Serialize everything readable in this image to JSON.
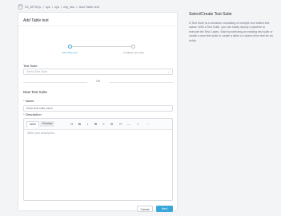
{
  "breadcrumb": {
    "segments": [
      "33_MYSQL",
      "sys",
      "sys",
      "city_sku",
      "Add Table test"
    ],
    "separator": "/"
  },
  "card": {
    "title": "Add Table test",
    "steps": [
      {
        "label": "Add Table test",
        "state": "active"
      },
      {
        "label": "Configure test case",
        "state": "pending"
      }
    ],
    "test_suite": {
      "label": "Test Suite",
      "placeholder": "Select Test Suite"
    },
    "or_text": "OR",
    "new_section_title": "New Test Suite",
    "name": {
      "label": "Name",
      "required_mark": "*",
      "placeholder": "Enter test suite name"
    },
    "description": {
      "label": "Description",
      "required_mark": "*",
      "tabs": {
        "write": "Write",
        "preview": "Preview"
      },
      "toolbar_icons": [
        "heading-icon",
        "bold-icon",
        "italic-icon",
        "strikethrough-icon",
        "bullet-list-icon",
        "numbered-list-icon",
        "link-icon",
        "horizontal-rule-icon",
        "code-icon",
        "more-icon"
      ],
      "placeholder": "Write your description"
    },
    "buttons": {
      "cancel": "Cancel",
      "next": "Next"
    }
  },
  "side_panel": {
    "title": "Select/Create Test Suite",
    "text": "A Test Suite is a container consisting of multiple but related test cases. With a Test Suite, you can easily deploy a pipeline to execute the Test Cases. Start by selecting an existing test suite or create a new test suite to create a table or column level test for an entity."
  },
  "colors": {
    "accent": "#3aa7d8",
    "required": "#d23c3c",
    "background": "#f3f4f6"
  }
}
